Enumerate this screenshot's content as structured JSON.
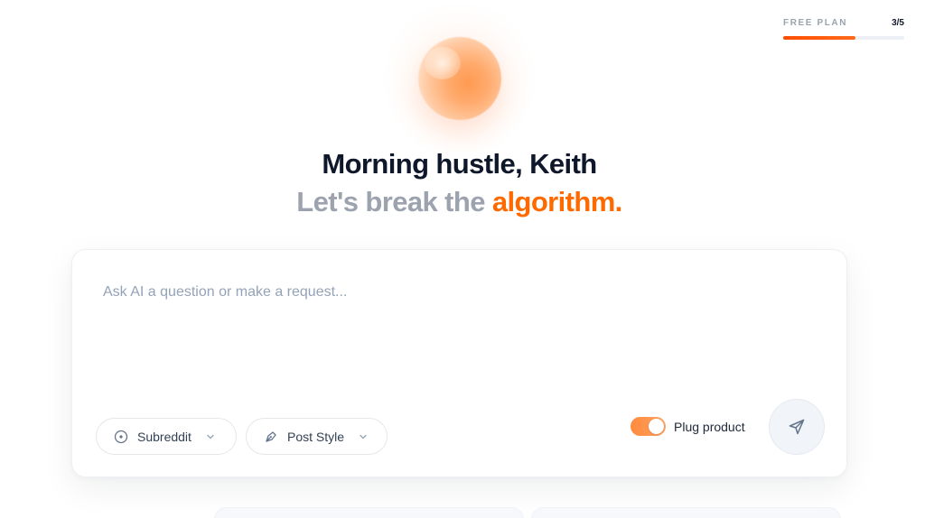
{
  "plan": {
    "label": "FREE PLAN",
    "used": 3,
    "total": 5,
    "count_text": "3/5",
    "progress_fraction": 0.6,
    "accent_color": "#ff5a0a"
  },
  "hero": {
    "greeting": "Morning hustle, Keith",
    "tagline_prefix": "Let's break the ",
    "tagline_accent": "algorithm.",
    "accent_color": "#ff6a00"
  },
  "composer": {
    "placeholder": "Ask AI a question or make a request...",
    "value": "",
    "subreddit_chip": {
      "label": "Subreddit",
      "icon": "subreddit-circle-icon"
    },
    "post_style_chip": {
      "label": "Post Style",
      "icon": "pen-nib-icon"
    },
    "plug_product": {
      "label": "Plug product",
      "enabled": true
    },
    "send_icon": "send-icon"
  }
}
